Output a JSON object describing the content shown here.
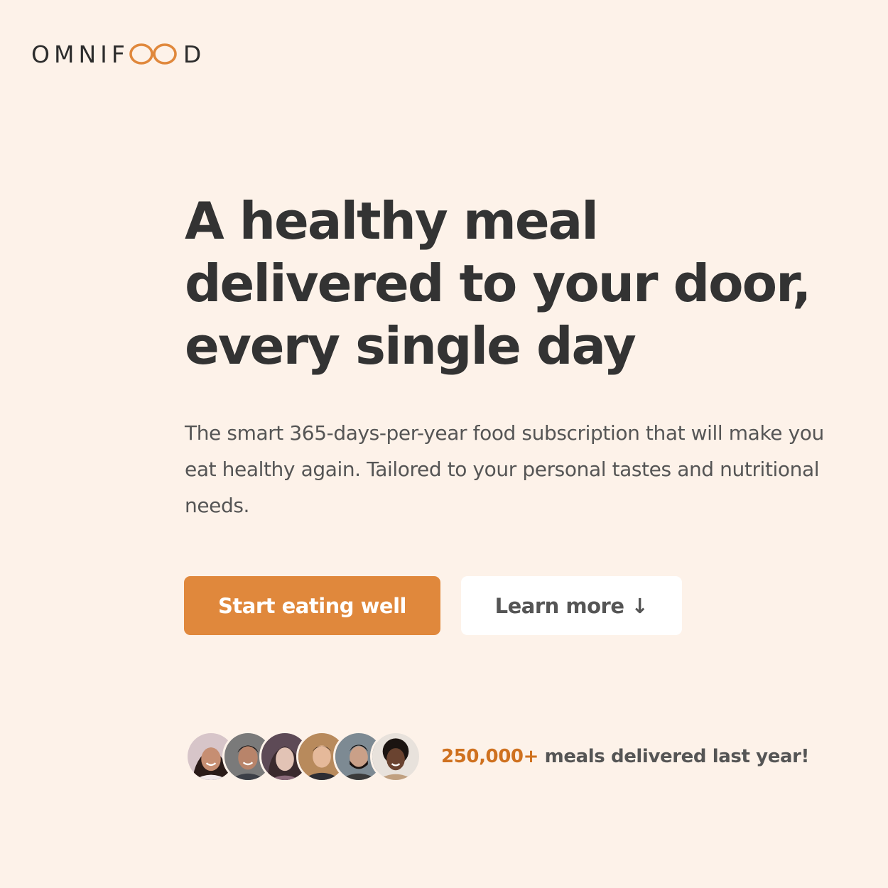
{
  "logo": {
    "text_before": "OMNIF",
    "text_after": "D",
    "accent_color": "#e0883c"
  },
  "hero": {
    "title": "A healthy meal delivered to your door, every single day",
    "description": "The smart 365-days-per-year food subscription that will make you eat healthy again. Tailored to your personal tastes and nutritional needs.",
    "primary_button_label": "Start eating well",
    "secondary_button_label": "Learn more",
    "secondary_button_icon": "arrow-down-icon",
    "secondary_button_icon_glyph": "↓"
  },
  "delivered": {
    "highlight": "250,000+",
    "text": " meals delivered last year!",
    "customers": [
      {
        "icon": "customer-avatar"
      },
      {
        "icon": "customer-avatar"
      },
      {
        "icon": "customer-avatar"
      },
      {
        "icon": "customer-avatar"
      },
      {
        "icon": "customer-avatar"
      },
      {
        "icon": "customer-avatar"
      }
    ]
  },
  "colors": {
    "background": "#fdf2e9",
    "primary": "#e0883c",
    "highlight": "#cf711f",
    "text_dark": "#333333",
    "text_body": "#555555"
  }
}
